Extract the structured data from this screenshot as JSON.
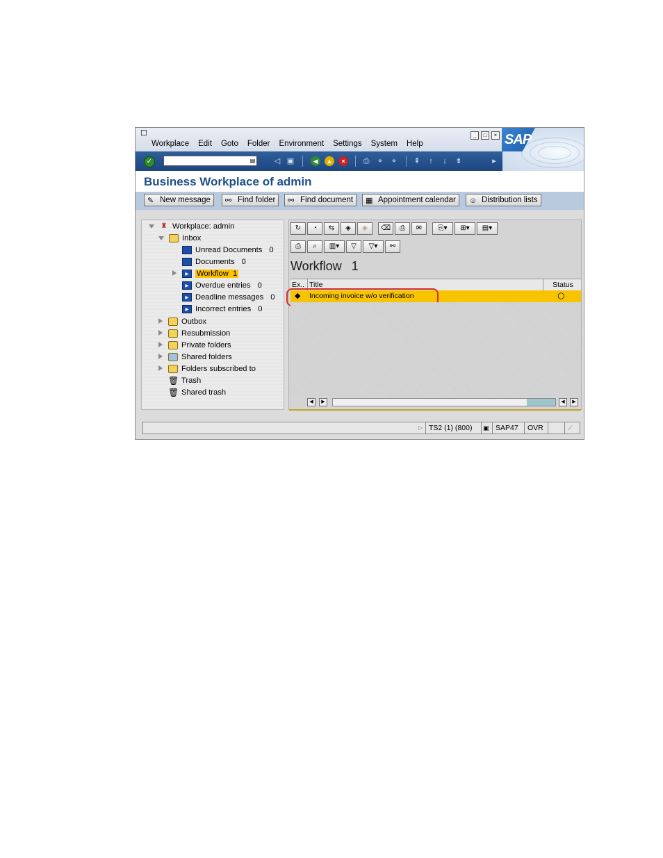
{
  "menu": [
    "Workplace",
    "Edit",
    "Goto",
    "Folder",
    "Environment",
    "Settings",
    "System",
    "Help"
  ],
  "logo_text": "SAP",
  "page_title": "Business Workplace of admin",
  "app_toolbar": [
    {
      "label": "New message",
      "icon": "pencil-note-icon"
    },
    {
      "label": "Find folder",
      "icon": "binoculars-icon"
    },
    {
      "label": "Find document",
      "icon": "binoculars-icon"
    },
    {
      "label": "Appointment calendar",
      "icon": "calendar-icon"
    },
    {
      "label": "Distribution lists",
      "icon": "people-icon"
    }
  ],
  "tree": {
    "root": "Workplace: admin",
    "inbox": "Inbox",
    "inbox_items": [
      {
        "label": "Unread Documents",
        "count": "0"
      },
      {
        "label": "Documents",
        "count": "0"
      },
      {
        "label": "Workflow",
        "count": "1"
      },
      {
        "label": "Overdue entries",
        "count": "0"
      },
      {
        "label": "Deadline messages",
        "count": "0"
      },
      {
        "label": "Incorrect entries",
        "count": "0"
      }
    ],
    "folders": [
      "Outbox",
      "Resubmission",
      "Private folders",
      "Shared folders",
      "Folders subscribed to",
      "Trash",
      "Shared trash"
    ]
  },
  "list": {
    "title": "Workflow",
    "count": "1",
    "columns": [
      "Ex..",
      "Title",
      "Status"
    ],
    "rows": [
      {
        "title": "Incoming invoice w/o verification"
      }
    ]
  },
  "status_bar": {
    "system": "TS2 (1) (800)",
    "server": "SAP47",
    "mode": "OVR"
  },
  "colors": {
    "title_blue": "#1e4e87",
    "selection_yellow": "#f8c400",
    "highlight_red": "#d12d2d"
  }
}
